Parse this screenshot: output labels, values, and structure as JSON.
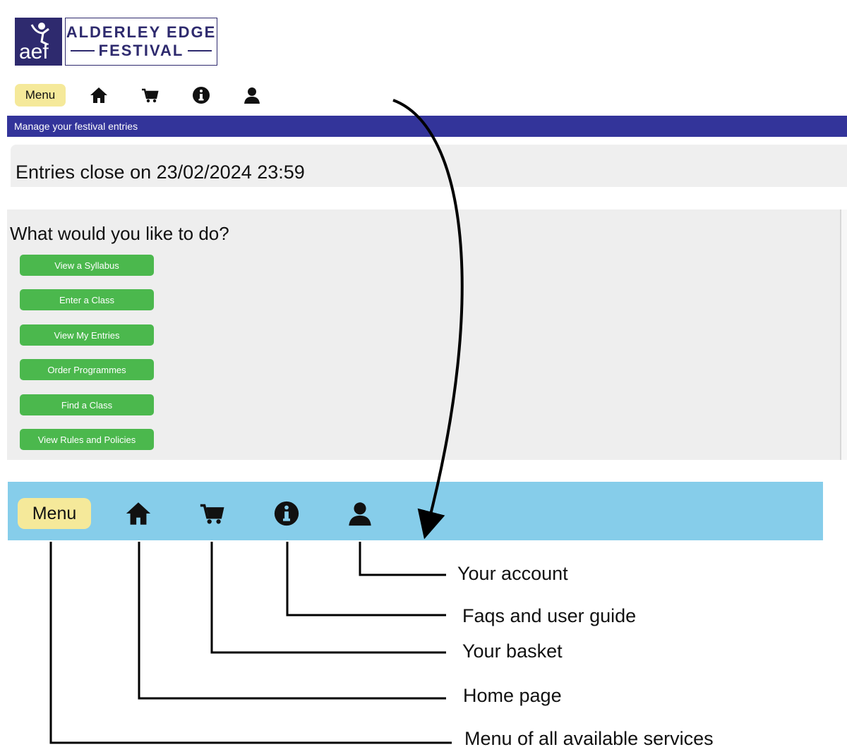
{
  "logo": {
    "mark_text": "aef",
    "line1": "ALDERLEY EDGE",
    "line2": "FESTIVAL"
  },
  "topnav": {
    "menu_label": "Menu",
    "icons": [
      "home-icon",
      "basket-icon",
      "info-icon",
      "user-icon"
    ]
  },
  "header": {
    "title": "Manage your festival entries"
  },
  "entries": {
    "close_text": "Entries close on 23/02/2024 23:59"
  },
  "actions": {
    "title": "What would you like to do?",
    "buttons": [
      "View a Syllabus",
      "Enter a Class",
      "View My Entries",
      "Order Programmes",
      "Find a Class",
      "View Rules and Policies"
    ]
  },
  "bignav": {
    "menu_label": "Menu",
    "icons": [
      "home-icon",
      "basket-icon",
      "info-icon",
      "user-icon"
    ]
  },
  "callouts": {
    "account": "Your account",
    "faqs": "Faqs and user guide",
    "basket": "Your basket",
    "home": "Home page",
    "menu": "Menu of all available services"
  },
  "colors": {
    "header_bar": "#33349a",
    "green_button": "#4bb84d",
    "menu_button": "#f5e99a",
    "big_nav": "#86cdea",
    "logo": "#2e2a6e"
  }
}
